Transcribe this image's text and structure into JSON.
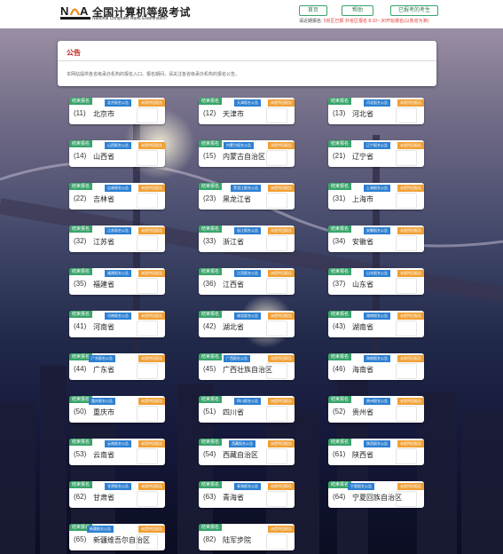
{
  "header": {
    "brand_cn": "全国计算机等级考试",
    "brand_en": "National Computer Rank Examination",
    "buttons": [
      "首页",
      "帮助",
      "已报考的考生"
    ],
    "stat_prefix": "请近期报名:",
    "stat_a": "5省区已报",
    "stat_b": "外省区报名",
    "stat_c": "8.10~",
    "stat_d": "30开始报名(以各省为准)"
  },
  "notice": {
    "title": "公告",
    "text": "本网站提供各省级承办机构的报名入口。报名期间，请关注各省级承办机构的报名公告。"
  },
  "colors": {
    "status": "#39a46a",
    "link": "#2d80d2",
    "nolink": "#f0a035",
    "title": "#c62828"
  },
  "cards": [
    {
      "num": "(11)",
      "name": "北京市",
      "status": "结束报名",
      "link": "北京报名公告",
      "nolink": "未提供回报告"
    },
    {
      "num": "(12)",
      "name": "天津市",
      "status": "结束报名",
      "link": "天津报名公告",
      "nolink": "未提供回报告"
    },
    {
      "num": "(13)",
      "name": "河北省",
      "status": "结束报名",
      "link": "河北报名公告",
      "nolink": "未提供回报告"
    },
    {
      "num": "(14)",
      "name": "山西省",
      "status": "结束报名",
      "link": "山西报名公告",
      "nolink": "未提供回报告"
    },
    {
      "num": "(15)",
      "name": "内蒙古自治区",
      "status": "结束报名",
      "link": "内蒙古报名公告",
      "nolink": "未提供回报告"
    },
    {
      "num": "(21)",
      "name": "辽宁省",
      "status": "结束报名",
      "link": "辽宁报名公告",
      "nolink": "未提供回报告"
    },
    {
      "num": "(22)",
      "name": "吉林省",
      "status": "结束报名",
      "link": "吉林报名公告",
      "nolink": "未提供回报告"
    },
    {
      "num": "(23)",
      "name": "黑龙江省",
      "status": "结束报名",
      "link": "黑龙江报名公告",
      "nolink": "未提供回报告"
    },
    {
      "num": "(31)",
      "name": "上海市",
      "status": "结束报名",
      "link": "上海报名公告",
      "nolink": "未提供回报告"
    },
    {
      "num": "(32)",
      "name": "江苏省",
      "status": "结束报名",
      "link": "江苏报名公告",
      "nolink": "未提供回报告"
    },
    {
      "num": "(33)",
      "name": "浙江省",
      "status": "结束报名",
      "link": "浙江报名公告",
      "nolink": "未提供回报告"
    },
    {
      "num": "(34)",
      "name": "安徽省",
      "status": "结束报名",
      "link": "安徽报名公告",
      "nolink": "未提供回报告"
    },
    {
      "num": "(35)",
      "name": "福建省",
      "status": "结束报名",
      "link": "福建报名公告",
      "nolink": "未提供回报告"
    },
    {
      "num": "(36)",
      "name": "江西省",
      "status": "结束报名",
      "link": "江西报名公告",
      "nolink": "未提供回报告"
    },
    {
      "num": "(37)",
      "name": "山东省",
      "status": "结束报名",
      "link": "山东报名公告",
      "nolink": "未提供回报告"
    },
    {
      "num": "(41)",
      "name": "河南省",
      "status": "结束报名",
      "link": "河南报名公告",
      "nolink": "未提供回报告"
    },
    {
      "num": "(42)",
      "name": "湖北省",
      "status": "结束报名",
      "link": "湖北报名公告",
      "nolink": "未提供回报告"
    },
    {
      "num": "(43)",
      "name": "湖南省",
      "status": "结束报名",
      "link": "湖南报名公告",
      "nolink": "未提供回报告"
    },
    {
      "num": "(44)",
      "name": "广东省",
      "status": "结束报名",
      "link": "广东报名公告",
      "nolink": "未提供回报告"
    },
    {
      "num": "(45)",
      "name": "广西壮族自治区",
      "status": "结束报名",
      "link": "广西报名公告",
      "nolink": "未提供回报告"
    },
    {
      "num": "(46)",
      "name": "海南省",
      "status": "结束报名",
      "link": "海南报名公告",
      "nolink": "未提供回报告"
    },
    {
      "num": "(50)",
      "name": "重庆市",
      "status": "结束报名",
      "link": "重庆报名公告",
      "nolink": "未提供回报告"
    },
    {
      "num": "(51)",
      "name": "四川省",
      "status": "结束报名",
      "link": "四川报名公告",
      "nolink": "未提供回报告"
    },
    {
      "num": "(52)",
      "name": "贵州省",
      "status": "结束报名",
      "link": "贵州报名公告",
      "nolink": "未提供回报告"
    },
    {
      "num": "(53)",
      "name": "云南省",
      "status": "结束报名",
      "link": "云南报名公告",
      "nolink": "未提供回报告"
    },
    {
      "num": "(54)",
      "name": "西藏自治区",
      "status": "结束报名",
      "link": "西藏报名公告",
      "nolink": "未提供回报告"
    },
    {
      "num": "(61)",
      "name": "陕西省",
      "status": "结束报名",
      "link": "陕西报名公告",
      "nolink": "未提供回报告"
    },
    {
      "num": "(62)",
      "name": "甘肃省",
      "status": "结束报名",
      "link": "甘肃报名公告",
      "nolink": "未提供回报告"
    },
    {
      "num": "(63)",
      "name": "青海省",
      "status": "结束报名",
      "link": "青海报名公告",
      "nolink": "未提供回报告"
    },
    {
      "num": "(64)",
      "name": "宁夏回族自治区",
      "status": "结束报名",
      "link": "宁夏报名公告",
      "nolink": "未提供回报告"
    },
    {
      "num": "(65)",
      "name": "新疆维吾尔自治区",
      "status": "结束报名",
      "link": "新疆报名公告",
      "nolink": "未提供回报告"
    },
    {
      "num": "(82)",
      "name": "陆军步院",
      "status": "结束报名",
      "link": "",
      "nolink": "未提供回报告"
    }
  ]
}
